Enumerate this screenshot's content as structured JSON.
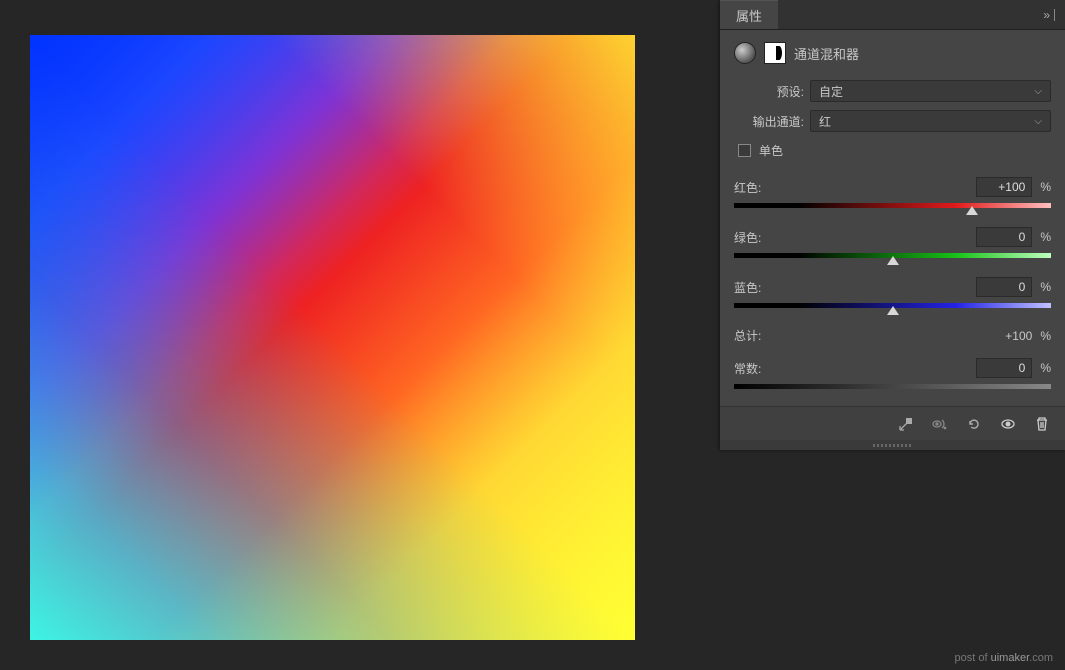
{
  "panel": {
    "tab": "属性",
    "title": "通道混和器",
    "preset_label": "预设:",
    "preset_value": "自定",
    "output_label": "输出通道:",
    "output_value": "红",
    "mono_label": "单色",
    "mono_checked": false,
    "sliders": {
      "red": {
        "label": "红色:",
        "value": "+100",
        "pos": 75
      },
      "green": {
        "label": "绿色:",
        "value": "0",
        "pos": 50
      },
      "blue": {
        "label": "蓝色:",
        "value": "0",
        "pos": 50
      }
    },
    "total_label": "总计:",
    "total_value": "+100",
    "constant": {
      "label": "常数:",
      "value": "0",
      "pos": 0
    },
    "percent": "%"
  },
  "watermark": {
    "prefix": "post of ",
    "brand": "uimaker",
    "suffix": ".com"
  }
}
